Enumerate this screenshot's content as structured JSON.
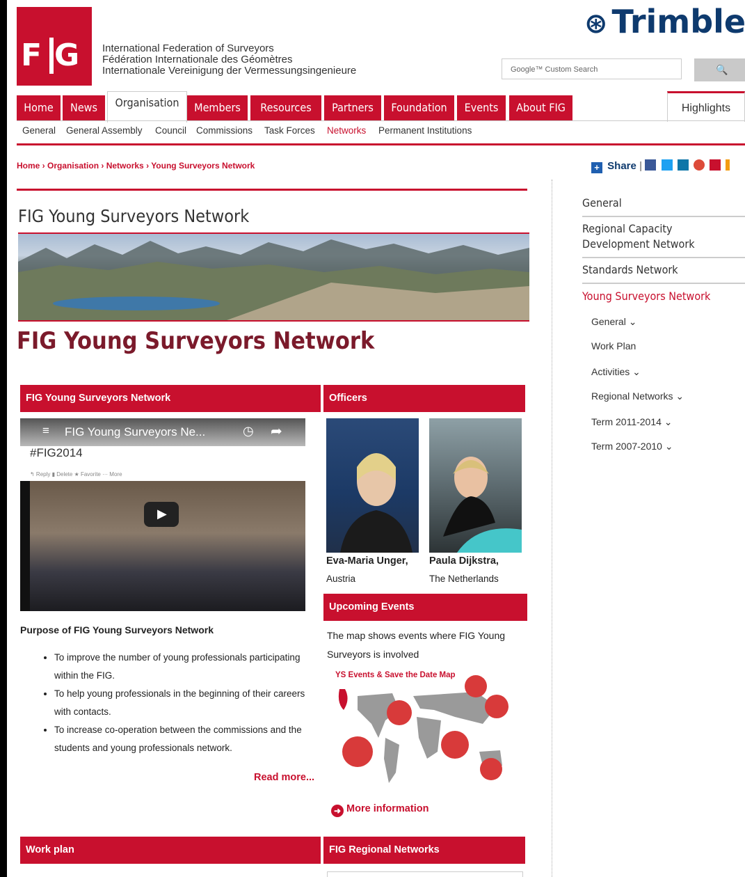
{
  "header": {
    "logo_text": "FIG",
    "org_names": [
      "International Federation of Surveyors",
      "Fédération Internationale des Géomètres",
      "Internationale Vereinigung der Vermessungsingenieure"
    ],
    "sponsor": "Trimble",
    "search_placeholder": "Google™ Custom Search",
    "search_button": "🔍"
  },
  "nav": {
    "tabs": [
      "Home",
      "News",
      "Organisation",
      "Members",
      "Resources",
      "Partners",
      "Foundation",
      "Events",
      "About FIG"
    ],
    "active_tab": "Organisation",
    "highlights": "Highlights",
    "subnav": [
      "General",
      "General Assembly",
      "Council",
      "Commissions",
      "Task Forces",
      "Networks",
      "Permanent Institutions"
    ],
    "active_sub": "Networks"
  },
  "breadcrumb": {
    "items": [
      "Home",
      "Organisation",
      "Networks",
      "Young Surveyors Network"
    ]
  },
  "share": {
    "label": "Share"
  },
  "main": {
    "page_title": "FIG Young Surveyors Network",
    "heading": "FIG Young Surveyors Network",
    "box_video_title": "FIG Young Surveyors Network",
    "video": {
      "title": "FIG Young Surveyors Ne...",
      "hashtag": "#FIG2014",
      "controls": "↰ Reply  ▮ Delete  ★ Favorite  ··· More"
    },
    "purpose_title": "Purpose of FIG Young Surveyors Network",
    "purpose_items": [
      "To improve the number of young professionals participating within the FIG.",
      "To help young professionals in the beginning of their careers with contacts.",
      "To increase co-operation between the commissions and the students and young professionals network."
    ],
    "read_more": "Read more...",
    "officers_title": "Officers",
    "officers": [
      {
        "name": "Eva-Maria Unger,",
        "country": "Austria"
      },
      {
        "name": "Paula Dijkstra,",
        "country": "The Netherlands"
      }
    ],
    "events_title": "Upcoming Events",
    "events_text": "The map shows events where FIG Young Surveyors is involved",
    "map_title": "YS Events & Save the Date Map",
    "more_info": "More information",
    "work_plan_title": "Work plan",
    "regional_title": "FIG Regional Networks"
  },
  "sidebar": {
    "items": [
      "General",
      "Regional Capacity Development Network",
      "Standards Network",
      "Young Surveyors Network"
    ],
    "active": "Young Surveyors Network",
    "sub_items": [
      "General ⌄",
      "Work Plan",
      "Activities ⌄",
      "Regional Networks ⌄",
      "Term 2011-2014 ⌄",
      "Term 2007-2010 ⌄"
    ]
  },
  "colors": {
    "accent": "#c8102e",
    "heading": "#7b1a2b",
    "sponsor_blue": "#0e3a6e"
  }
}
